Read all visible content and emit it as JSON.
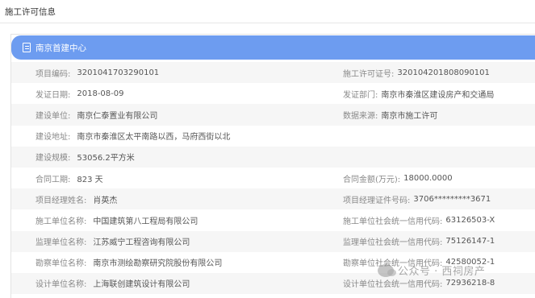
{
  "page": {
    "title": "施工许可信息"
  },
  "panel": {
    "header_title": "南京首建中心"
  },
  "rows": [
    {
      "left_label": "项目编码:",
      "left_value": "3201041703290101",
      "right_label": "施工许可证号:",
      "right_value": "320104201808090101"
    },
    {
      "left_label": "发证日期:",
      "left_value": "2018-08-09",
      "right_label": "发证部门:",
      "right_value": "南京市秦淮区建设房产和交通局"
    },
    {
      "left_label": "建设单位:",
      "left_value": "南京仁泰置业有限公司",
      "right_label": "数据来源:",
      "right_value": "南京市施工许可"
    },
    {
      "left_label": "建设地址:",
      "left_value": "南京市秦淮区太平南路以西，马府西街以北",
      "right_label": "",
      "right_value": ""
    },
    {
      "left_label": "建设规模:",
      "left_value": "53056.2平方米",
      "right_label": "",
      "right_value": ""
    },
    {
      "left_label": "合同工期:",
      "left_value": "823 天",
      "right_label": "合同金额(万元):",
      "right_value": "18000.0000"
    },
    {
      "left_label": "项目经理姓名:",
      "left_value": "肖英杰",
      "right_label": "项目经理证件号码:",
      "right_value": "3706*********3671"
    },
    {
      "left_label": "施工单位名称:",
      "left_value": "中国建筑第八工程局有限公司",
      "right_label": "施工单位社会统一信用代码:",
      "right_value": "63126503-X"
    },
    {
      "left_label": "监理单位名称:",
      "left_value": "江苏威宁工程咨询有限公司",
      "right_label": "监理单位社会统一信用代码:",
      "right_value": "75126147-1"
    },
    {
      "left_label": "勘察单位名称:",
      "left_value": "南京市测绘勘察研究院股份有限公司",
      "right_label": "勘察单位社会统一信用代码:",
      "right_value": "42580052-1"
    },
    {
      "left_label": "设计单位名称:",
      "left_value": "上海联创建筑设计有限公司",
      "right_label": "设计单位社会统一信用代码:",
      "right_value": "72936218-8"
    }
  ],
  "watermark": {
    "text": "公众号 · 西祠房产"
  }
}
